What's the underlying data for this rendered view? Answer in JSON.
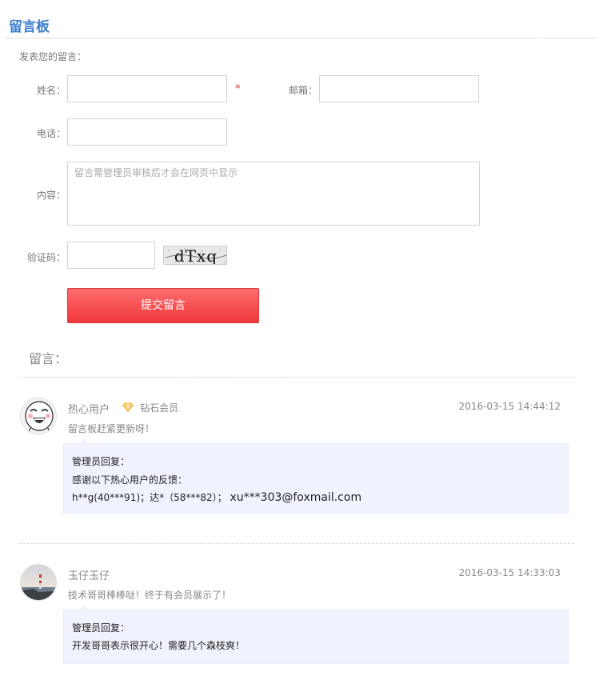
{
  "page": {
    "title": "留言板",
    "form_intro": "发表您的留言："
  },
  "form": {
    "name_label": "姓名：",
    "name_required": "*",
    "email_label": "邮箱：",
    "phone_label": "电话：",
    "content_label": "内容：",
    "content_placeholder": "留言需管理员审核后才会在网页中显示",
    "captcha_label": "验证码：",
    "captcha_text": "dTxq",
    "submit_label": "提交留言"
  },
  "comments_section": {
    "title": "留言："
  },
  "comments": [
    {
      "user": "热心用户",
      "badge": "钻石会员",
      "timestamp": "2016-03-15 14:44:12",
      "message": "留言板赶紧更新呀！",
      "reply_title": "管理员回复：",
      "reply_lines": [
        "感谢以下热心用户的反馈：",
        "h**g(40***91)；达*（58***82）；",
        "xu***303@foxmail.com"
      ]
    },
    {
      "user": "玉仔玉仔",
      "timestamp": "2016-03-15 14:33:03",
      "message": "技术哥哥棒棒哒！终于有会员展示了！",
      "reply_title": "管理员回复：",
      "reply_lines": [
        "开发哥哥表示很开心！需要几个森枝爽！"
      ]
    }
  ],
  "colors": {
    "title_blue": "#3d7fcf",
    "submit_red": "#f0393c",
    "reply_bg": "#f0f3fd",
    "diamond": "#f3b32f"
  }
}
